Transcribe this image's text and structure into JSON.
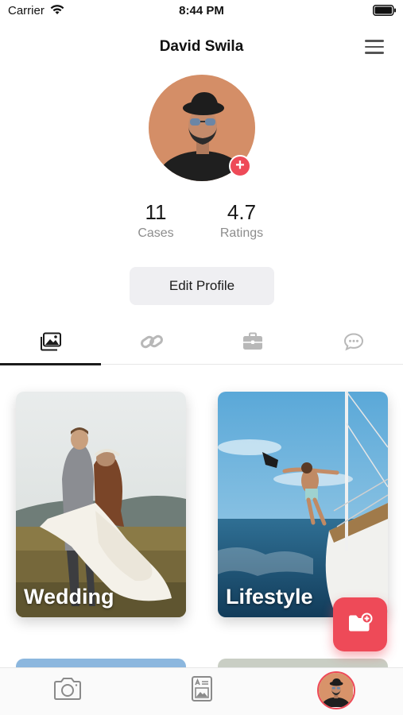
{
  "status_bar": {
    "carrier": "Carrier",
    "time": "8:44 PM"
  },
  "header": {
    "title": "David Swila"
  },
  "profile": {
    "stats": [
      {
        "value": "11",
        "label": "Cases"
      },
      {
        "value": "4.7",
        "label": "Ratings"
      }
    ],
    "edit_button": "Edit Profile"
  },
  "tabs": [
    {
      "icon": "gallery-icon",
      "selected": true
    },
    {
      "icon": "link-icon",
      "selected": false
    },
    {
      "icon": "briefcase-icon",
      "selected": false
    },
    {
      "icon": "chat-icon",
      "selected": false
    }
  ],
  "albums": [
    {
      "label": "Wedding"
    },
    {
      "label": "Lifestyle"
    }
  ],
  "bottom_nav": [
    {
      "icon": "camera-icon"
    },
    {
      "icon": "portfolio-icon"
    },
    {
      "icon": "profile-avatar"
    }
  ],
  "colors": {
    "accent": "#ee4a58",
    "text": "#1b1b1b",
    "muted": "#8d8d8d",
    "button_bg": "#efeff2"
  }
}
